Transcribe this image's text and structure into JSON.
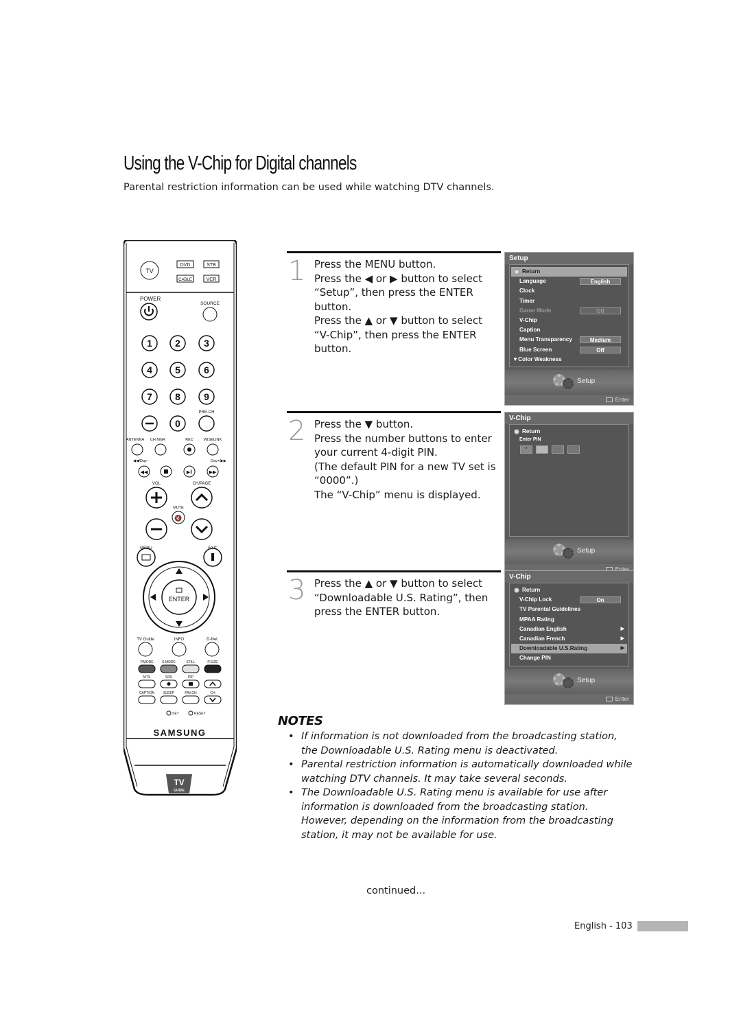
{
  "page": {
    "title": "Using the V-Chip for Digital channels",
    "subtitle": "Parental restriction information can be used while watching DTV channels.",
    "continued": "continued...",
    "footer": "English - 103"
  },
  "remote": {
    "brand": "SAMSUNG",
    "logo": "TV GUIDE",
    "mode_buttons": [
      "TV",
      "DVD",
      "STB",
      "CABLE",
      "VCR"
    ],
    "power": "POWER",
    "source": "SOURCE",
    "digits": [
      "1",
      "2",
      "3",
      "4",
      "5",
      "6",
      "7",
      "8",
      "9",
      "0"
    ],
    "pre_ch": "PRE-CH",
    "row_labels": [
      "ANTENNA",
      "CH MGR",
      "REC",
      "WISELINK"
    ],
    "rewind_label": "◀◀/Day–",
    "ff_label": "Day+/▶▶",
    "vol": "VOL",
    "ch_page": "CH/PAGE",
    "mute": "MUTE",
    "menu": "MENU",
    "exit": "EXIT",
    "enter": "ENTER",
    "bottom_labels": [
      "TV Guide",
      "INFO",
      "D-Net"
    ],
    "color_labels": [
      "P.MODE",
      "S.MODE",
      "STILL",
      "P.SIZE"
    ],
    "func_labels": [
      "MTS",
      "SRS",
      "PIP",
      "CAPTION",
      "SLEEP",
      "FAV.CH",
      "CH"
    ],
    "set": "SET",
    "reset": "RESET"
  },
  "steps": [
    {
      "number": "1",
      "lines": [
        "Press the MENU button.",
        "Press the ◀ or ▶ button to select",
        "“Setup”, then press the ENTER",
        "button.",
        "Press the ▲ or ▼ button to select",
        "“V-Chip”, then press the ENTER",
        "button."
      ]
    },
    {
      "number": "2",
      "lines": [
        "Press the ▼ button.",
        "Press the number buttons to enter",
        "your current 4-digit PIN.",
        "(The default PIN for a new TV set is",
        "“0000”.)",
        "The “V-Chip” menu is displayed."
      ]
    },
    {
      "number": "3",
      "lines": [
        "Press the ▲ or ▼ button to select",
        "“Downloadable U.S. Rating”, then",
        "press the ENTER button."
      ]
    }
  ],
  "screens": {
    "setup": {
      "title": "Setup",
      "return": "Return",
      "items": [
        {
          "label": "Language",
          "value": "English"
        },
        {
          "label": "Clock"
        },
        {
          "label": "Timer"
        },
        {
          "label": "Game Mode",
          "value": "Off",
          "disabled": true
        },
        {
          "label": "V-Chip"
        },
        {
          "label": "Caption"
        },
        {
          "label": "Menu Transparency",
          "value": "Medium"
        },
        {
          "label": "Blue Screen",
          "value": "Off"
        },
        {
          "label": "▼Color Weakness"
        }
      ],
      "footer": "Setup",
      "enter": "Enter"
    },
    "pin": {
      "title": "V-Chip",
      "return": "Return",
      "pin_label": "Enter PIN",
      "pin_boxes": [
        "*",
        "",
        "",
        ""
      ],
      "footer": "Setup",
      "enter": "Enter"
    },
    "vchip": {
      "title": "V-Chip",
      "return": "Return",
      "items": [
        {
          "label": "V-Chip Lock",
          "value": "On"
        },
        {
          "label": "TV Parental Guidelines"
        },
        {
          "label": "MPAA Rating"
        },
        {
          "label": "Canadian English",
          "arrow": "▶"
        },
        {
          "label": "Canadian French",
          "arrow": "▶"
        },
        {
          "label": "Downloadable U.S.Rating",
          "arrow": "▶",
          "highlighted": true
        },
        {
          "label": "Change PIN"
        }
      ],
      "footer": "Setup",
      "enter": "Enter"
    }
  },
  "notes": {
    "title": "NOTES",
    "items": [
      [
        "If information is not downloaded from the broadcasting station,",
        "the Downloadable U.S. Rating menu is deactivated."
      ],
      [
        "Parental restriction information is automatically downloaded while",
        "watching DTV channels. It may take several seconds."
      ],
      [
        "The Downloadable U.S. Rating menu is available for use after",
        "information is downloaded from the broadcasting station.",
        "However, depending on the information from the broadcasting",
        "station, it may not be available for use."
      ]
    ]
  }
}
